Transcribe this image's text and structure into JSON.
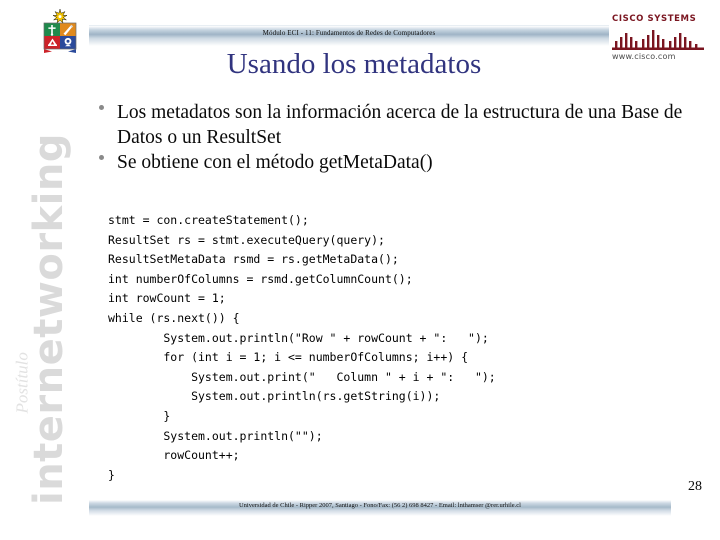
{
  "branding": {
    "vertical_word": "internetworking",
    "vertical_sub": "Postítulo",
    "crest_icon": "universidad-de-chile-crest-icon"
  },
  "header": {
    "course_line": "Módulo ECI - 11: Fundamentos de Redes de Computadores",
    "logo": {
      "name": "CISCO SYSTEMS",
      "url": "www.cisco.com",
      "icon": "cisco-bridge-icon",
      "brand_color": "#7a1520"
    }
  },
  "slide": {
    "title": "Usando los metadatos",
    "title_color": "#31347f",
    "bullets": [
      "Los metadatos son la información acerca de la estructura de una Base de Datos o un  ResultSet",
      "Se obtiene con el método getMetaData()"
    ],
    "code": "stmt = con.createStatement();\nResultSet rs = stmt.executeQuery(query);\nResultSetMetaData rsmd = rs.getMetaData();\nint numberOfColumns = rsmd.getColumnCount();\nint rowCount = 1;\nwhile (rs.next()) {\n        System.out.println(\"Row \" + rowCount + \":   \");\n        for (int i = 1; i <= numberOfColumns; i++) {\n            System.out.print(\"   Column \" + i + \":   \");\n            System.out.println(rs.getString(i));\n        }\n        System.out.println(\"\");\n        rowCount++;\n}",
    "page_number": "28"
  },
  "footer": {
    "text": "Universidad de Chile - Ripper 2007, Santiago - Fono/Fax: (56 2) 698 8427 - Email: lnthamser @rer.urhile.cl"
  }
}
